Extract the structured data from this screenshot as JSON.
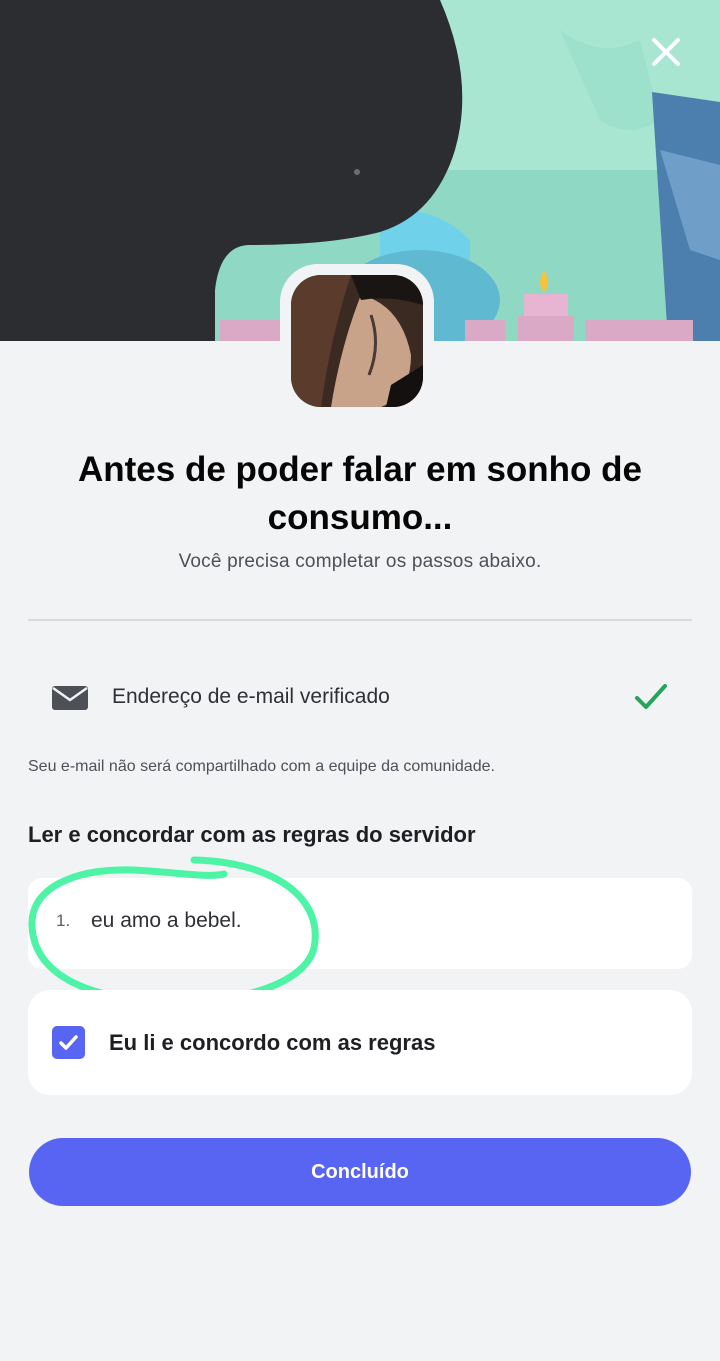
{
  "header": {
    "close_icon": "close-icon"
  },
  "colors": {
    "accent": "#5865f2",
    "success": "#23a55a",
    "annotation": "#4df4a6"
  },
  "title": "Antes de poder falar em sonho de consumo...",
  "subtitle": "Você precisa completar os passos abaixo.",
  "email": {
    "icon": "mail-icon",
    "label": "Endereço de e-mail verificado",
    "status_icon": "check-icon",
    "note": "Seu e-mail não será compartilhado com a equipe da comunidade."
  },
  "rules": {
    "heading": "Ler e concordar com as regras do servidor",
    "items": [
      {
        "number": "1.",
        "text": "eu amo a bebel."
      }
    ]
  },
  "agreement": {
    "label": "Eu li e concordo com as regras",
    "checked": true
  },
  "done_button": "Concluído"
}
